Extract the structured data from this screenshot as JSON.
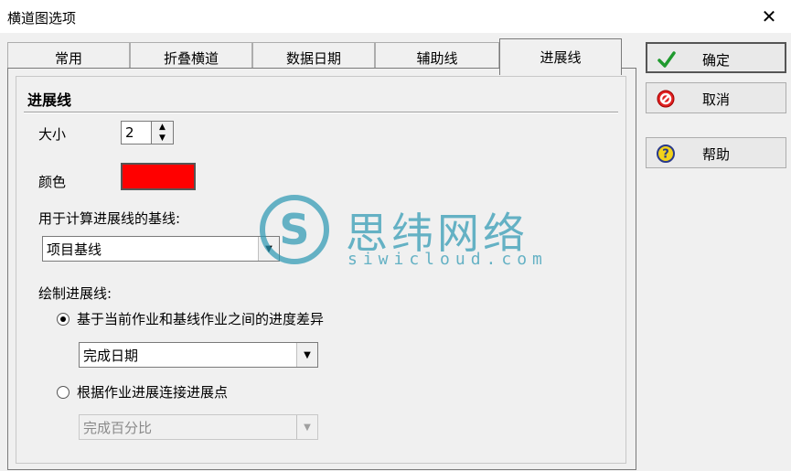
{
  "window": {
    "title": "横道图选项",
    "close_icon": "✕"
  },
  "tabs": [
    {
      "label": "常用",
      "active": false
    },
    {
      "label": "折叠横道",
      "active": false
    },
    {
      "label": "数据日期",
      "active": false
    },
    {
      "label": "辅助线",
      "active": false
    },
    {
      "label": "进展线",
      "active": true
    }
  ],
  "panel": {
    "section_title": "进展线",
    "size_label": "大小",
    "size_value": "2",
    "color_label": "颜色",
    "color_value": "#ff0000",
    "baseline_label": "用于计算进展线的基线:",
    "baseline_value": "项目基线",
    "draw_label": "绘制进展线:",
    "option1": {
      "label": "基于当前作业和基线作业之间的进度差异",
      "checked": true,
      "combo_value": "完成日期"
    },
    "option2": {
      "label": "根据作业进展连接进展点",
      "checked": false,
      "combo_value": "完成百分比"
    }
  },
  "buttons": {
    "ok": {
      "label": "确定",
      "icon": "check-icon"
    },
    "cancel": {
      "label": "取消",
      "icon": "cancel-icon"
    },
    "help": {
      "label": "帮助",
      "icon": "help-icon"
    }
  },
  "watermark": {
    "letter": "S",
    "cn": "思纬网络",
    "en": "siwicloud.com"
  }
}
